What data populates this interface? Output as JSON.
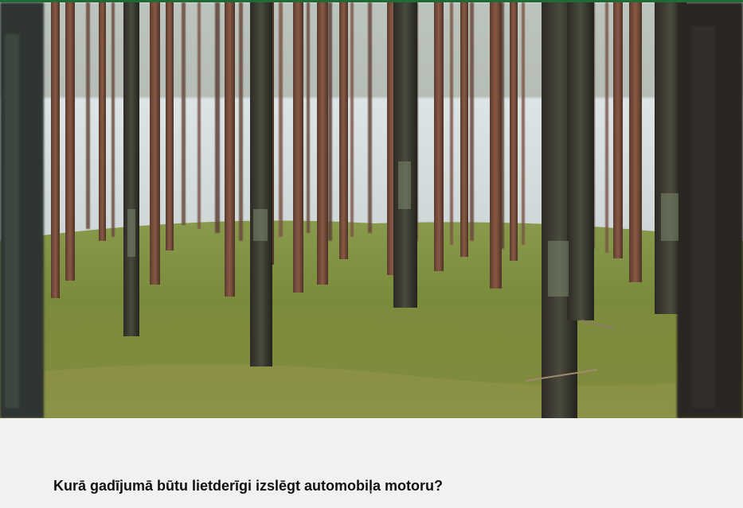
{
  "header": {
    "accent_color": "#1f6a35"
  },
  "hero": {
    "icon": "forest-photo"
  },
  "quiz": {
    "question": "Kurā gadījumā būtu lietderīgi izslēgt automobiļa motoru?"
  },
  "colors": {
    "page_background": "#f1f1f1",
    "moss": "#7e8f3f",
    "sky": "#dfe6ea",
    "bark": "#4a3a2e"
  }
}
